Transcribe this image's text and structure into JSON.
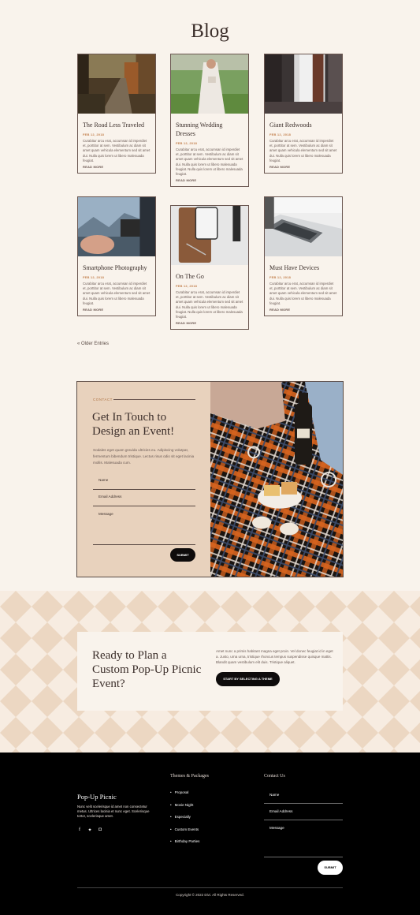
{
  "blog": {
    "title": "Blog",
    "posts": [
      {
        "title": "The Road Less Traveled",
        "date": "FEB 12, 2018",
        "excerpt": "Curabitur arcu erat, accumsan id imperdiet et, porttitor at sem. Vestibulum ac diam sit amet quam vehicula elementum sed sit amet dui. Nulla quis lorem ut libero malesuada feugiat.",
        "more": "READ MORE"
      },
      {
        "title": "Stunning Wedding Dresses",
        "date": "FEB 12, 2018",
        "excerpt": "Curabitur arcu erat, accumsan id imperdiet et, porttitor at sem. Vestibulum ac diam sit amet quam vehicula elementum sed sit amet dui. Nulla quis lorem ut libero malesuada feugiat. Nulla quis lorem ut libero malesuada feugiat.",
        "more": "READ MORE"
      },
      {
        "title": "Giant Redwoods",
        "date": "FEB 12, 2018",
        "excerpt": "Curabitur arcu erat, accumsan id imperdiet et, porttitor at sem. Vestibulum ac diam sit amet quam vehicula elementum sed sit amet dui. Nulla quis lorem ut libero malesuada feugiat.",
        "more": "READ MORE"
      },
      {
        "title": "Smartphone Photography",
        "date": "FEB 12, 2018",
        "excerpt": "Curabitur arcu erat, accumsan id imperdiet et, porttitor at sem. Vestibulum ac diam sit amet quam vehicula elementum sed sit amet dui. Nulla quis lorem ut libero malesuada feugiat.",
        "more": "READ MORE"
      },
      {
        "title": "On The Go",
        "date": "FEB 12, 2018",
        "excerpt": "Curabitur arcu erat, accumsan id imperdiet et, porttitor at sem. Vestibulum ac diam sit amet quam vehicula elementum sed sit amet dui. Nulla quis lorem ut libero malesuada feugiat. Nulla quis lorem ut libero malesuada feugiat.",
        "more": "READ MORE"
      },
      {
        "title": "Must Have Devices",
        "date": "FEB 12, 2018",
        "excerpt": "Curabitur arcu erat, accumsan id imperdiet et, porttitor at sem. Vestibulum ac diam sit amet quam vehicula elementum sed sit amet dui. Nulla quis lorem ut libero malesuada feugiat.",
        "more": "READ MORE"
      }
    ],
    "older_entries": "« Older Entries"
  },
  "contact": {
    "eyebrow": "CONTACT",
    "heading": "Get In Touch to Design an Event!",
    "text": "Sodales eget quam gravida ultricies eu. Adipiscing volutpat, fermentum bibendum tristique. Lectus risus odio sit eget lacinia mollis. Malesuada cum.",
    "fields": {
      "name": "Name",
      "email": "Email Address",
      "message": "Message"
    },
    "submit": "SUBMIT"
  },
  "plan": {
    "heading": "Ready to Plan a Custom Pop-Up Picnic Event?",
    "text": "Amet nunc a primis habitant magna eget proin. Vel donec feugiat id in eget a. Justo, urna urna, tristique rhoncus tempus suspendisse quisque mattis. Blandit quam vestibulum elit duis. Tristique aliquet.",
    "button": "START BY SELECTING A THEME"
  },
  "footer": {
    "brand": "Pop-Up Picnic",
    "description": "Nunc velit scelerisque id amet non consectetur metus. Ultrices lacinia et nunc eget. Scelerisque tortor, scelerisque amet.",
    "socials": [
      "facebook-icon",
      "twitter-icon",
      "instagram-icon"
    ],
    "themes_title": "Themes & Packages",
    "themes": [
      "Proposal",
      "Movie Night",
      "Especially",
      "Custom Events",
      "Birthday Parties"
    ],
    "contact_title": "Contact Us",
    "fields": {
      "name": "Name",
      "email": "Email Address",
      "message": "Message"
    },
    "submit": "SUBMIT",
    "copyright": "Copyright © 2022 Divi. All Rights Reserved."
  },
  "colors": {
    "background": "#f9f3ec",
    "accent": "#c2804e",
    "dark": "#0e0b0b",
    "contact_panel": "#e8d2bd"
  }
}
